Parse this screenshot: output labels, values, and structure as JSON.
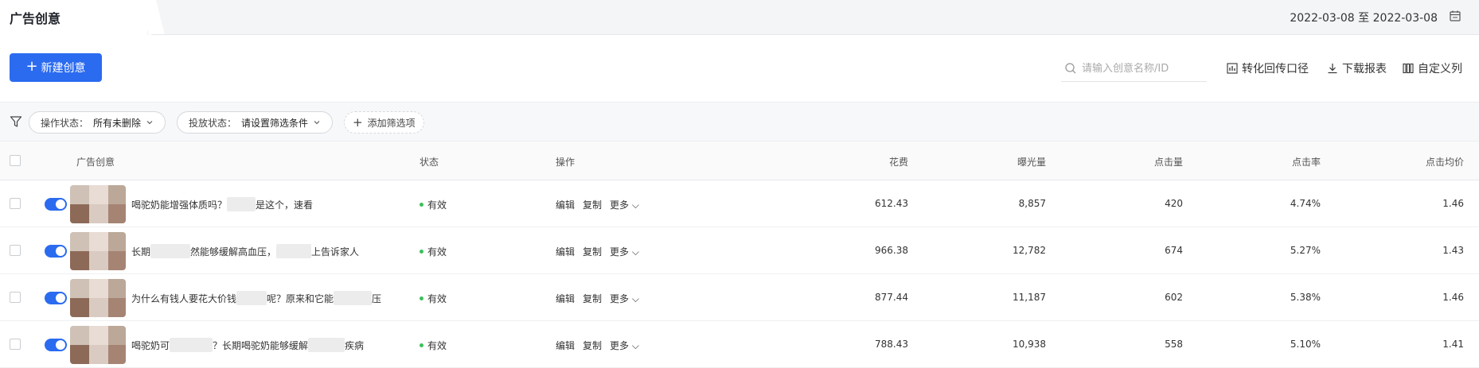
{
  "header": {
    "title": "广告创意",
    "date_start": "2022-03-08",
    "date_sep": "至",
    "date_end": "2022-03-08"
  },
  "toolbar": {
    "new_button": "新建创意",
    "search_placeholder": "请输入创意名称/ID",
    "conversion": "转化回传口径",
    "download": "下载报表",
    "custom_columns": "自定义列"
  },
  "filters": {
    "op_status_label": "操作状态：",
    "op_status_value": "所有未删除",
    "delivery_label": "投放状态：",
    "delivery_value": "请设置筛选条件",
    "add_filter": "添加筛选项"
  },
  "columns": {
    "creative": "广告创意",
    "status": "状态",
    "actions": "操作",
    "cost": "花费",
    "impressions": "曝光量",
    "clicks": "点击量",
    "ctr": "点击率",
    "cpc": "点击均价"
  },
  "row_actions": {
    "edit": "编辑",
    "copy": "复制",
    "more": "更多"
  },
  "rows": [
    {
      "t1": "喝驼奶能增强体质吗？",
      "t2": "是这个，速看",
      "status": "有效",
      "cost": "612.43",
      "impressions": "8,857",
      "clicks": "420",
      "ctr": "4.74%",
      "cpc": "1.46"
    },
    {
      "t1": "长期",
      "t2": "然能够缓解高血压，",
      "t3": "上告诉家人",
      "status": "有效",
      "cost": "966.38",
      "impressions": "12,782",
      "clicks": "674",
      "ctr": "5.27%",
      "cpc": "1.43"
    },
    {
      "t1": "为什么有钱人要花大价钱",
      "t2": "呢？原来和它能",
      "t3": "压",
      "status": "有效",
      "cost": "877.44",
      "impressions": "11,187",
      "clicks": "602",
      "ctr": "5.38%",
      "cpc": "1.46"
    },
    {
      "t1": "喝驼奶可",
      "t2": "？长期喝驼奶能够缓解",
      "t3": "疾病",
      "status": "有效",
      "cost": "788.43",
      "impressions": "10,938",
      "clicks": "558",
      "ctr": "5.10%",
      "cpc": "1.41"
    }
  ],
  "colors": {
    "primary": "#2b6bf0",
    "valid": "#3cbf5b"
  }
}
